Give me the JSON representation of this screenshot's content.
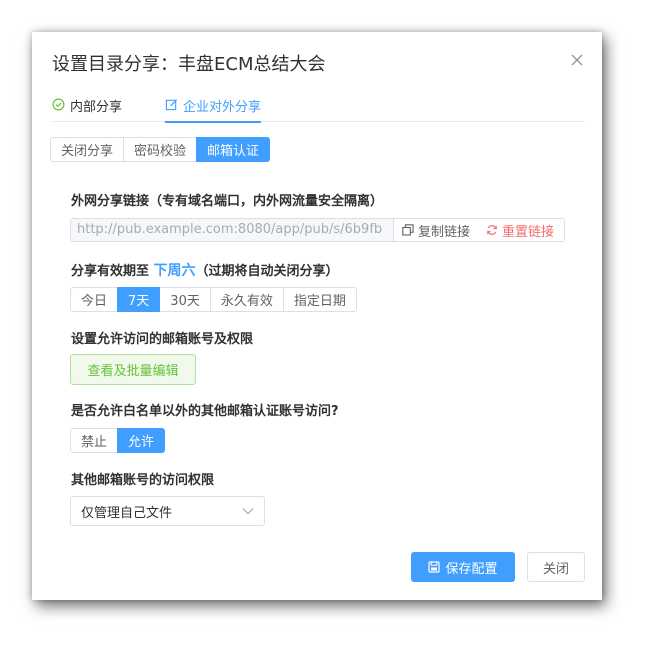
{
  "dialog": {
    "title": "设置目录分享：丰盘ECM总结大会"
  },
  "tabs": [
    {
      "label": "内部分享",
      "icon": "check-circle-icon"
    },
    {
      "label": "企业对外分享",
      "icon": "edit-icon",
      "active": true
    }
  ],
  "share_mode": {
    "options": [
      "关闭分享",
      "密码校验",
      "邮箱认证"
    ],
    "selected": "邮箱认证"
  },
  "link_section": {
    "label": "外网分享链接（专有域名端口，内外网流量安全隔离）",
    "url": "http://pub.example.com:8080/app/pub/s/6b9fb",
    "copy_label": "复制链接",
    "reset_label": "重置链接"
  },
  "expiry": {
    "label_prefix": "分享有效期至",
    "highlight": "下周六",
    "label_suffix": "（过期将自动关闭分享）",
    "options": [
      "今日",
      "7天",
      "30天",
      "永久有效",
      "指定日期"
    ],
    "selected": "7天"
  },
  "email_access": {
    "label": "设置允许访问的邮箱账号及权限",
    "button": "查看及批量编辑"
  },
  "whitelist": {
    "label": "是否允许白名单以外的其他邮箱认证账号访问?",
    "options": [
      "禁止",
      "允许"
    ],
    "selected": "允许"
  },
  "other_permission": {
    "label": "其他邮箱账号的访问权限",
    "value": "仅管理自己文件"
  },
  "footer": {
    "save_label": "保存配置",
    "close_label": "关闭"
  },
  "colors": {
    "primary": "#409eff",
    "success": "#67c23a",
    "danger": "#f56c6c"
  }
}
